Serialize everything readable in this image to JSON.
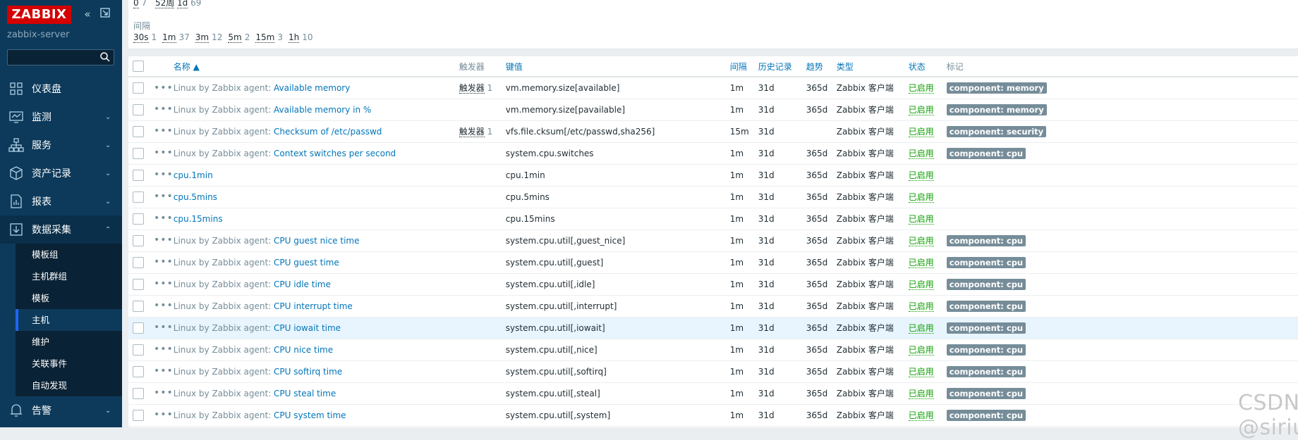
{
  "sidebar": {
    "logo": "ZABBIX",
    "server_name": "zabbix-server",
    "search_placeholder": "",
    "menu": [
      {
        "label": "仪表盘"
      },
      {
        "label": "监测"
      },
      {
        "label": "服务"
      },
      {
        "label": "资产记录"
      },
      {
        "label": "报表"
      },
      {
        "label": "数据采集"
      },
      {
        "label": "告警"
      }
    ],
    "submenu": [
      {
        "label": "模板组"
      },
      {
        "label": "主机群组"
      },
      {
        "label": "模板"
      },
      {
        "label": "主机"
      },
      {
        "label": "维护"
      },
      {
        "label": "关联事件"
      },
      {
        "label": "自动发现"
      }
    ]
  },
  "filter": {
    "top_line": {
      "a": "0",
      "a_count": "7",
      "b": "52周",
      "c": "1d",
      "c_count": "69"
    },
    "interval_label": "间隔",
    "intervals": [
      {
        "label": "30s",
        "count": "1"
      },
      {
        "label": "1m",
        "count": "37"
      },
      {
        "label": "3m",
        "count": "12"
      },
      {
        "label": "5m",
        "count": "2"
      },
      {
        "label": "15m",
        "count": "3"
      },
      {
        "label": "1h",
        "count": "10"
      }
    ]
  },
  "table": {
    "headers": {
      "name": "名称 ▲",
      "triggers": "触发器",
      "key": "键值",
      "interval": "间隔",
      "history": "历史记录",
      "trends": "趋势",
      "type": "类型",
      "status": "状态",
      "tags": "标记"
    },
    "rows": [
      {
        "template": "Linux by Zabbix agent",
        "name": "Available memory",
        "trig_label": "触发器",
        "trig_count": "1",
        "key": "vm.memory.size[available]",
        "interval": "1m",
        "history": "31d",
        "trends": "365d",
        "type": "Zabbix 客户端",
        "status": "已启用",
        "tag": "component: memory"
      },
      {
        "template": "Linux by Zabbix agent",
        "name": "Available memory in %",
        "trig_label": "",
        "trig_count": "",
        "key": "vm.memory.size[pavailable]",
        "interval": "1m",
        "history": "31d",
        "trends": "365d",
        "type": "Zabbix 客户端",
        "status": "已启用",
        "tag": "component: memory"
      },
      {
        "template": "Linux by Zabbix agent",
        "name": "Checksum of /etc/passwd",
        "trig_label": "触发器",
        "trig_count": "1",
        "key": "vfs.file.cksum[/etc/passwd,sha256]",
        "interval": "15m",
        "history": "31d",
        "trends": "",
        "type": "Zabbix 客户端",
        "status": "已启用",
        "tag": "component: security"
      },
      {
        "template": "Linux by Zabbix agent",
        "name": "Context switches per second",
        "trig_label": "",
        "trig_count": "",
        "key": "system.cpu.switches",
        "interval": "1m",
        "history": "31d",
        "trends": "365d",
        "type": "Zabbix 客户端",
        "status": "已启用",
        "tag": "component: cpu"
      },
      {
        "template": "",
        "name": "cpu.1min",
        "trig_label": "",
        "trig_count": "",
        "key": "cpu.1min",
        "interval": "1m",
        "history": "31d",
        "trends": "365d",
        "type": "Zabbix 客户端",
        "status": "已启用",
        "tag": ""
      },
      {
        "template": "",
        "name": "cpu.5mins",
        "trig_label": "",
        "trig_count": "",
        "key": "cpu.5mins",
        "interval": "1m",
        "history": "31d",
        "trends": "365d",
        "type": "Zabbix 客户端",
        "status": "已启用",
        "tag": ""
      },
      {
        "template": "",
        "name": "cpu.15mins",
        "trig_label": "",
        "trig_count": "",
        "key": "cpu.15mins",
        "interval": "1m",
        "history": "31d",
        "trends": "365d",
        "type": "Zabbix 客户端",
        "status": "已启用",
        "tag": ""
      },
      {
        "template": "Linux by Zabbix agent",
        "name": "CPU guest nice time",
        "trig_label": "",
        "trig_count": "",
        "key": "system.cpu.util[,guest_nice]",
        "interval": "1m",
        "history": "31d",
        "trends": "365d",
        "type": "Zabbix 客户端",
        "status": "已启用",
        "tag": "component: cpu"
      },
      {
        "template": "Linux by Zabbix agent",
        "name": "CPU guest time",
        "trig_label": "",
        "trig_count": "",
        "key": "system.cpu.util[,guest]",
        "interval": "1m",
        "history": "31d",
        "trends": "365d",
        "type": "Zabbix 客户端",
        "status": "已启用",
        "tag": "component: cpu"
      },
      {
        "template": "Linux by Zabbix agent",
        "name": "CPU idle time",
        "trig_label": "",
        "trig_count": "",
        "key": "system.cpu.util[,idle]",
        "interval": "1m",
        "history": "31d",
        "trends": "365d",
        "type": "Zabbix 客户端",
        "status": "已启用",
        "tag": "component: cpu"
      },
      {
        "template": "Linux by Zabbix agent",
        "name": "CPU interrupt time",
        "trig_label": "",
        "trig_count": "",
        "key": "system.cpu.util[,interrupt]",
        "interval": "1m",
        "history": "31d",
        "trends": "365d",
        "type": "Zabbix 客户端",
        "status": "已启用",
        "tag": "component: cpu"
      },
      {
        "template": "Linux by Zabbix agent",
        "name": "CPU iowait time",
        "trig_label": "",
        "trig_count": "",
        "key": "system.cpu.util[,iowait]",
        "interval": "1m",
        "history": "31d",
        "trends": "365d",
        "type": "Zabbix 客户端",
        "status": "已启用",
        "tag": "component: cpu"
      },
      {
        "template": "Linux by Zabbix agent",
        "name": "CPU nice time",
        "trig_label": "",
        "trig_count": "",
        "key": "system.cpu.util[,nice]",
        "interval": "1m",
        "history": "31d",
        "trends": "365d",
        "type": "Zabbix 客户端",
        "status": "已启用",
        "tag": "component: cpu"
      },
      {
        "template": "Linux by Zabbix agent",
        "name": "CPU softirq time",
        "trig_label": "",
        "trig_count": "",
        "key": "system.cpu.util[,softirq]",
        "interval": "1m",
        "history": "31d",
        "trends": "365d",
        "type": "Zabbix 客户端",
        "status": "已启用",
        "tag": "component: cpu"
      },
      {
        "template": "Linux by Zabbix agent",
        "name": "CPU steal time",
        "trig_label": "",
        "trig_count": "",
        "key": "system.cpu.util[,steal]",
        "interval": "1m",
        "history": "31d",
        "trends": "365d",
        "type": "Zabbix 客户端",
        "status": "已启用",
        "tag": "component: cpu"
      },
      {
        "template": "Linux by Zabbix agent",
        "name": "CPU system time",
        "trig_label": "",
        "trig_count": "",
        "key": "system.cpu.util[,system]",
        "interval": "1m",
        "history": "31d",
        "trends": "365d",
        "type": "Zabbix 客户端",
        "status": "已启用",
        "tag": "component: cpu"
      }
    ]
  },
  "watermark": "CSDN @siriuuus"
}
